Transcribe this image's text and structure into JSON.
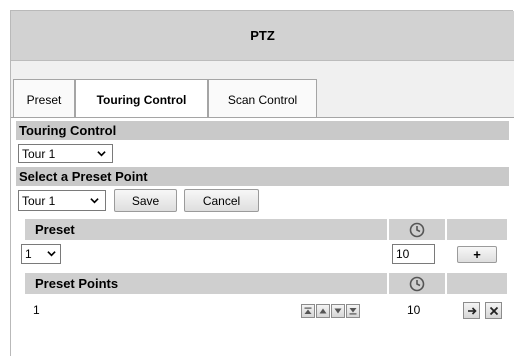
{
  "title": "PTZ",
  "tabs": [
    {
      "label": "Preset",
      "active": false
    },
    {
      "label": "Touring Control",
      "active": true
    },
    {
      "label": "Scan Control",
      "active": false
    }
  ],
  "touring": {
    "header": "Touring Control",
    "tour_select": "Tour 1"
  },
  "select_preset": {
    "header": "Select a Preset Point",
    "tour_select": "Tour 1",
    "save_label": "Save",
    "cancel_label": "Cancel"
  },
  "preset": {
    "header": "Preset",
    "preset_select": "1",
    "dwell_value": "10",
    "add_label": "+"
  },
  "preset_points": {
    "header": "Preset Points",
    "rows": [
      {
        "number": "1",
        "dwell": "10"
      }
    ]
  },
  "icons": {
    "clock": "clock-icon",
    "move_top": "move-top-icon",
    "move_up": "move-up-icon",
    "move_down": "move-down-icon",
    "move_bottom": "move-bottom-icon",
    "goto": "arrow-right-icon",
    "delete": "close-icon"
  },
  "colors": {
    "title_bar": "#d2d2d2",
    "section_header": "#c9c9c9",
    "tab_area": "#f0f0f0"
  }
}
